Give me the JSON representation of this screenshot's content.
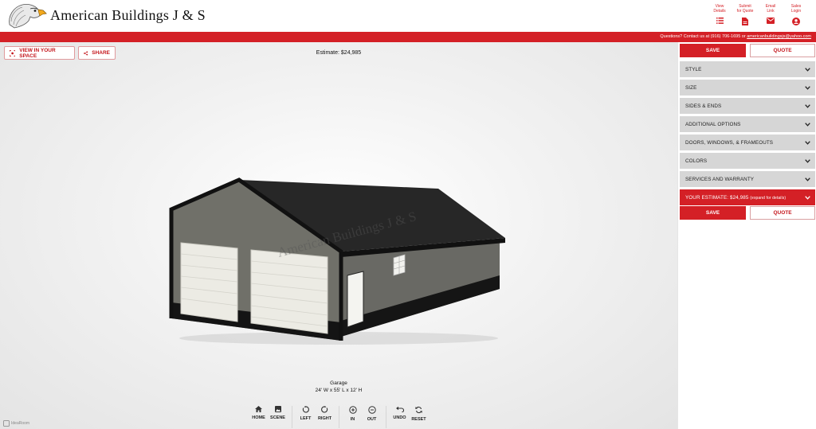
{
  "header": {
    "brand": "American Buildings J & S",
    "nav": [
      {
        "label": "View\nDetails",
        "icon": "list-icon"
      },
      {
        "label": "Submit\nfor Quote",
        "icon": "document-icon"
      },
      {
        "label": "Email\nLink",
        "icon": "mail-icon"
      },
      {
        "label": "Sales\nLogin",
        "icon": "account-icon"
      }
    ],
    "contact_prefix": "Questions? Contact us at (916) 706-1695 or ",
    "contact_email": "americanbuildingsjs@yahoo.com"
  },
  "viewer": {
    "view_in_space": "VIEW IN YOUR SPACE",
    "share": "SHARE",
    "estimate": "Estimate: $24,985",
    "building_watermark": "American Buildings J & S",
    "caption_title": "Garage",
    "caption_dims": "24' W x 55' L x 12' H",
    "controls": {
      "home": "HOME",
      "scene": "SCENE",
      "left": "LEFT",
      "right": "RIGHT",
      "in": "IN",
      "out": "OUT",
      "undo": "UNDO",
      "reset": "RESET"
    },
    "powered_by": "IdeaRoom"
  },
  "sidebar": {
    "save": "SAVE",
    "quote": "QUOTE",
    "sections": [
      "STYLE",
      "SIZE",
      "SIDES & ENDS",
      "ADDITIONAL OPTIONS",
      "DOORS, WINDOWS, & FRAMEOUTS",
      "COLORS",
      "SERVICES AND WARRANTY"
    ],
    "estimate_label": "YOUR ESTIMATE: $24,985",
    "estimate_hint": "(expand for details)"
  },
  "colors": {
    "brand_red": "#d42026",
    "accordion_gray": "#d6d6d6",
    "wall_gray": "#6b6b66",
    "roof_black": "#262626"
  }
}
